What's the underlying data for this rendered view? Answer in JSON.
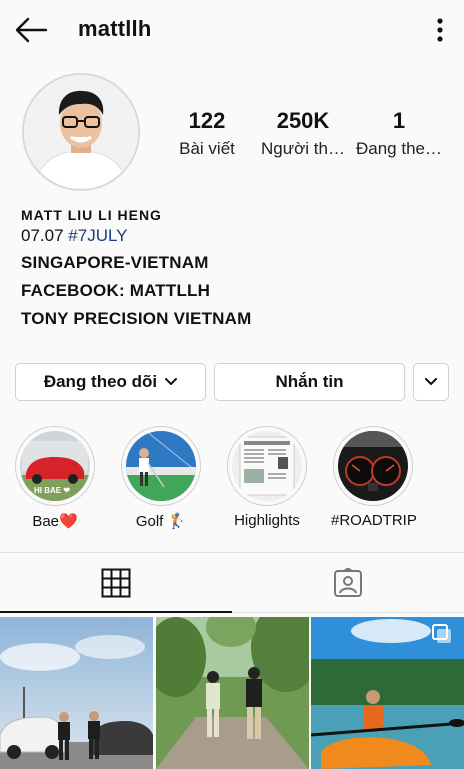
{
  "header": {
    "username": "mattllh",
    "back_icon": "arrow-left-icon",
    "more_icon": "more-vertical-icon"
  },
  "stats": [
    {
      "value": "122",
      "label": "Bài viết"
    },
    {
      "value": "250K",
      "label": "Người th…"
    },
    {
      "value": "1",
      "label": "Đang the…"
    }
  ],
  "bio": {
    "name": "MATT LIU LI HENG",
    "date": "07.07",
    "hashtag": "#7JULY",
    "lines": [
      "SINGAPORE-VIETNAM",
      "FACEBOOK: MATTLLH",
      "TONY PRECISION VIETNAM"
    ]
  },
  "actions": {
    "following_label": "Đang theo dõi",
    "message_label": "Nhắn tin"
  },
  "highlights": [
    {
      "label": "Bae❤️"
    },
    {
      "label": "Golf 🏌"
    },
    {
      "label": "Highlights"
    },
    {
      "label": "#ROADTRIP"
    }
  ],
  "highlight_overlay": {
    "bae_text": "HI BAE ❤"
  },
  "tabs": [
    "grid-icon",
    "tagged-user-icon"
  ],
  "colors": {
    "hashtag": "#1a3f7a",
    "background": "#fafafa"
  }
}
